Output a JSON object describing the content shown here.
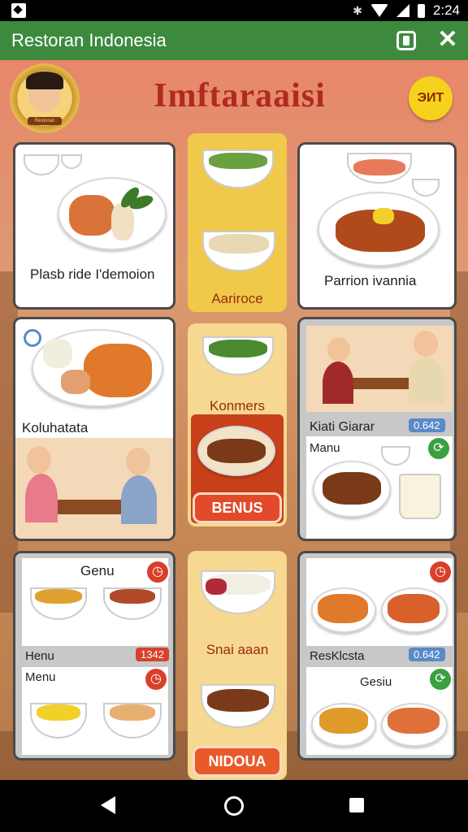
{
  "status_bar": {
    "time": "2:24",
    "icons": [
      "notification-icon",
      "bluetooth-icon",
      "wifi-icon",
      "signal-icon",
      "battery-icon"
    ]
  },
  "app_bar": {
    "title": "Restoran Indonesia",
    "icons": [
      "window-icon",
      "close-icon"
    ],
    "color": "#3d8a3f"
  },
  "game": {
    "title": "Imftaraaisi",
    "coin_label": "ЭИТ",
    "avatar": {
      "name": "Restoran"
    },
    "cards": {
      "top_left": {
        "caption": "Plasb ride I'demoion"
      },
      "top_right": {
        "caption": "Parrion ivannia"
      },
      "mid_left": {
        "caption": "Koluhatata"
      },
      "mid_right": {
        "caption": "Kiati Giarar",
        "tag": "0.642",
        "sub": "Manu"
      },
      "bottom_left": {
        "caption": "Genu",
        "sub1": "Henu",
        "tag": "1342",
        "sub2": "Menu"
      },
      "bottom_right": {
        "sub1": "ResKlcsta",
        "tag": "0.642",
        "sub2": "Gesiu"
      }
    },
    "center_column": {
      "label1": "Aariroce",
      "label2": "Konmers",
      "button1": "BENUS",
      "label3": "Snai aaan",
      "button2": "NIDOUA"
    }
  },
  "colors": {
    "accent": "#3d8a3f",
    "title": "#b02a1e",
    "button": "#e24a2a",
    "coin": "#f7d21c"
  }
}
